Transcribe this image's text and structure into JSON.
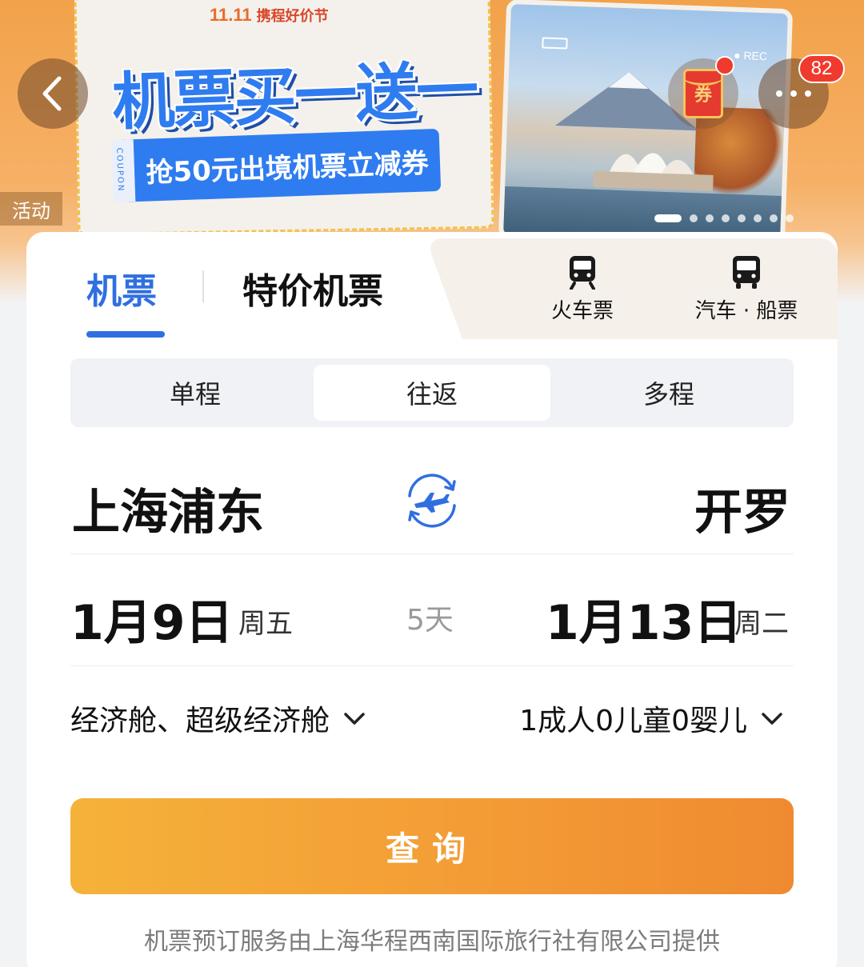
{
  "banner": {
    "festival": "11.11",
    "festival_name": "携程好价节",
    "title": "机票买一送一",
    "coupon_text": "抢50元出境机票立减券",
    "coupon_tag": "COUPON",
    "photo_rec": "● REC",
    "activity_label": "活动",
    "carousel_count": 8,
    "carousel_active_index": 0
  },
  "header": {
    "coupon_icon_label": "券",
    "notification_count": "82"
  },
  "tabs": {
    "flight": "机票",
    "special": "特价机票",
    "train": "火车票",
    "bus_ship": "汽车 · 船票"
  },
  "trip_types": [
    "单程",
    "往返",
    "多程"
  ],
  "trip_type_selected": "往返",
  "route": {
    "from": "上海浦东",
    "to": "开罗"
  },
  "dates": {
    "depart_date": "1月9日",
    "depart_weekday": "周五",
    "duration": "5天",
    "return_date": "1月13日",
    "return_weekday": "周二"
  },
  "options": {
    "cabin": "经济舱、超级经济舱",
    "passengers": "1成人0儿童0婴儿"
  },
  "search_button": "查询",
  "footer_note": "机票预订服务由上海华程西南国际旅行社有限公司提供",
  "colors": {
    "accent_blue": "#2f6fe0",
    "search_orange_start": "#f5b23a",
    "search_orange_end": "#ef8a31",
    "badge_red": "#f03a2e"
  }
}
